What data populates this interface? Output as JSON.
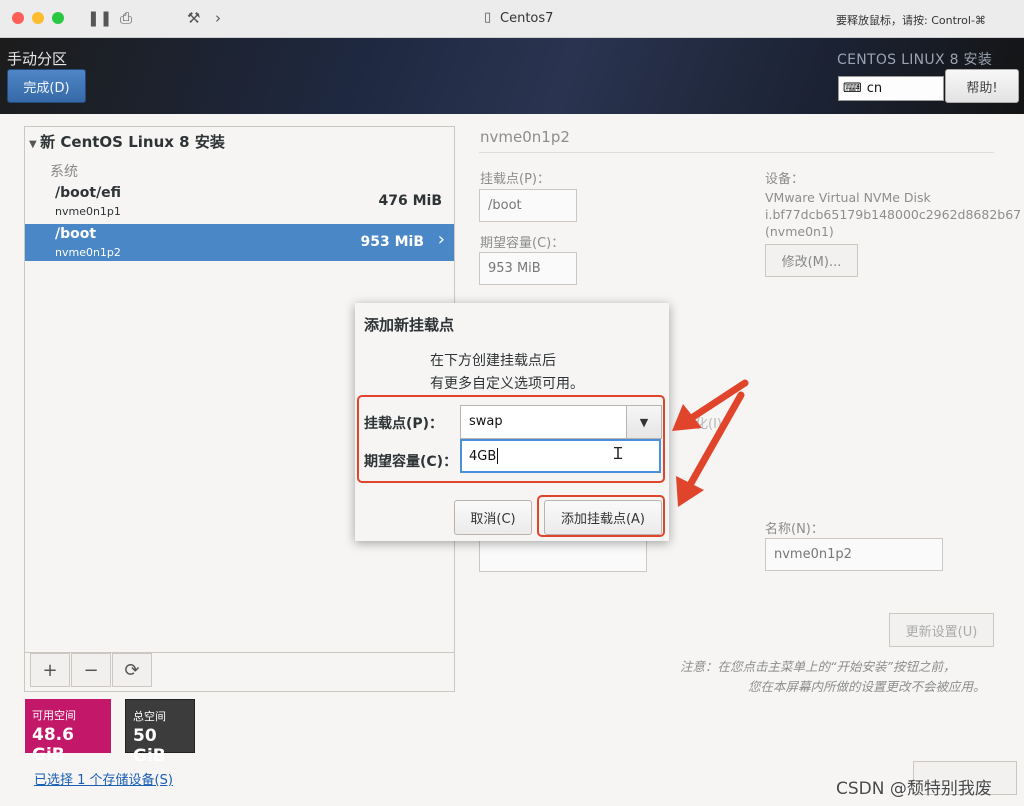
{
  "window": {
    "title": "Centos7",
    "release_hint": "要释放鼠标，请按: Control-⌘"
  },
  "header": {
    "page_title": "手动分区",
    "done_button": "完成(D)",
    "product_title": "CENTOS LINUX 8 安装",
    "keyboard_layout": "cn",
    "help_button": "帮助!"
  },
  "left_panel": {
    "install_title": "新 CentOS Linux 8 安装",
    "group_label": "系统",
    "partitions": [
      {
        "mount": "/boot/efi",
        "device": "nvme0n1p1",
        "size": "476 MiB",
        "selected": false
      },
      {
        "mount": "/boot",
        "device": "nvme0n1p2",
        "size": "953 MiB",
        "selected": true
      }
    ],
    "tools": [
      "+",
      "−",
      "⟳"
    ],
    "available_label": "可用空间",
    "available_value": "48.6 GiB",
    "total_label": "总空间",
    "total_value": "50 GiB",
    "storage_link": "已选择 1 个存储设备(S)"
  },
  "details": {
    "partition_name": "nvme0n1p2",
    "mount_label": "挂载点(P)：",
    "mount_value": "/boot",
    "capacity_label": "期望容量(C)：",
    "capacity_value": "953 MiB",
    "device_label": "设备：",
    "device_text": "VMware Virtual NVMe Disk i.bf77dcb65179b148000c2962d8682b67 (nvme0n1)",
    "modify_button": "修改(M)...",
    "name_label": "名称(N)：",
    "name_value": "nvme0n1p2",
    "update_button": "更新设置(U)",
    "note_line1": "注意：在您点击主菜单上的“开始安装”按钮之前，",
    "note_line2": "您在本屏幕内所做的设置更改不会被应用。",
    "ghost_text": "化(I)"
  },
  "dialog": {
    "title": "添加新挂载点",
    "desc_line1": "在下方创建挂载点后",
    "desc_line2": "有更多自定义选项可用。",
    "mount_label": "挂载点(P)：",
    "mount_value": "swap",
    "capacity_label": "期望容量(C)：",
    "capacity_value": "4GB",
    "cancel_button": "取消(C)",
    "add_button": "添加挂载点(A)"
  },
  "watermark": "CSDN @颓特别我废",
  "colors": {
    "accent_blue": "#4a87c6",
    "available_magenta": "#c3186a",
    "annotation_red": "#e0442a"
  }
}
